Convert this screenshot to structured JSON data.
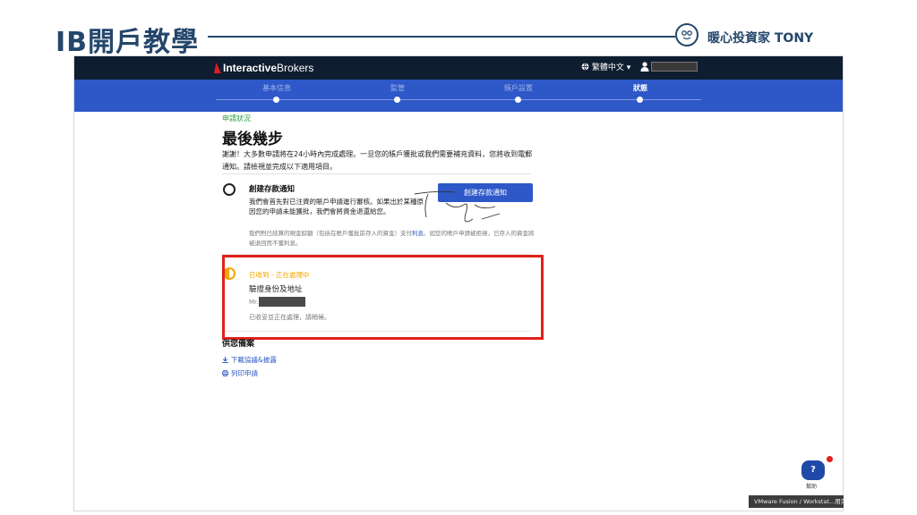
{
  "slide": {
    "title": "IB開戶教學",
    "brand": "暖心投資家 TONY",
    "brand_logo_icon": "smiling-face-circle-icon"
  },
  "topbar": {
    "logo_prefix": "Interactive",
    "logo_suffix": "Brokers",
    "language": "繁體中文 ▾",
    "language_icon": "globe-icon",
    "user_icon": "user-icon"
  },
  "progress": {
    "steps": [
      "基本信息",
      "監管",
      "賬戶設置",
      "狀態"
    ],
    "active_index": 3
  },
  "status_page": {
    "eyebrow": "申請狀況",
    "heading": "最後幾步",
    "intro": "謝謝！大多數申請將在24小時內完成處理。一旦您的賬戶獲批或我們需要補充資料，您將收到電郵通知。請檢視並完成以下適用項目。"
  },
  "todo": {
    "title": "創建存款通知",
    "description": "我們會首先對已注資的賬戶申請進行審核。如果出於某種原因您的申請未能獲批，我們會將資金退還給您。",
    "button_label": "創建存款通知",
    "note_prefix": "我們對已結算的現金餘額（包括在賬戶獲批前存入的資金）支付",
    "note_link": "利息",
    "note_suffix": "。如您的賬戶申請被拒絕，已存入的資金將被退回而不獲利息。"
  },
  "pending": {
    "status": "已收到 - 正在處理中",
    "title": "驗證身份及地址",
    "name_prefix": "Mr.",
    "description": "已收妥並正在處理，請稍候。"
  },
  "documents": {
    "heading": "供您備案",
    "download_label": "下載協議&披露",
    "print_label": "列印申請"
  },
  "help": {
    "label": "幫助",
    "icon": "?"
  },
  "taskbar_tooltip": "VMware Fusion / Workstat...用完",
  "colors": {
    "navy": "#0f1d30",
    "progress_blue": "#2e58c7",
    "accent_green": "#2e9d47",
    "pending_orange": "#f0a500",
    "highlight_red": "#e1201a",
    "slide_title": "#24476b"
  }
}
